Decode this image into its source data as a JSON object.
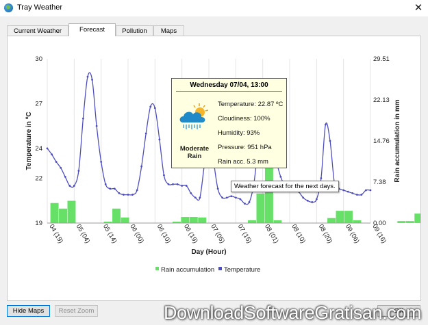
{
  "window": {
    "title": "Tray Weather",
    "close_glyph": "✕"
  },
  "tabs": [
    {
      "label": "Current Weather",
      "active": false
    },
    {
      "label": "Forecast",
      "active": true
    },
    {
      "label": "Pollution",
      "active": false
    },
    {
      "label": "Maps",
      "active": false
    }
  ],
  "popup": {
    "title": "Wednesday 07/04, 13:00",
    "condition": "Moderate Rain",
    "icon": "rain-cloud-sun-icon",
    "rows": [
      "Temperature: 22.87 ºC",
      "Cloudiness: 100%",
      "Humidity: 93%",
      "Pressure: 951 hPa",
      "Rain acc. 5.3 mm"
    ]
  },
  "tooltip": "Weather forecast for the next days.",
  "buttons": {
    "hide_maps": "Hide Maps",
    "reset_zoom": "Reset Zoom",
    "ok": "OK"
  },
  "watermark": "DownloadSoftwareGratisan.com",
  "colors": {
    "temperature": "#4d4dc0",
    "rain": "#66e066",
    "popup_bg": "#ffffe1"
  },
  "chart_data": {
    "type": "bar+line",
    "xlabel": "Day (Hour)",
    "ylabel_left": "Temperature in ºC",
    "ylabel_right": "Rain accumulation in mm",
    "x_ticks": [
      "04 (19)",
      "05 (04)",
      "05 (14)",
      "06 (00)",
      "06 (10)",
      "06 (19)",
      "07 (05)",
      "07 (15)",
      "08 (01)",
      "08 (10)",
      "08 (20)",
      "09 (06)",
      "09 (16)"
    ],
    "y_left_ticks": [
      "19",
      "22",
      "24",
      "27",
      "30"
    ],
    "y_right_ticks": [
      "0.00",
      "7.38",
      "14.76",
      "22.13",
      "29.51"
    ],
    "y_left_range": [
      19,
      30
    ],
    "y_right_range": [
      0,
      29.51
    ],
    "legend": [
      "Rain accumulation",
      "Temperature"
    ],
    "legend_position": "bottom",
    "series": [
      {
        "name": "Temperature",
        "kind": "line",
        "axis": "left",
        "x": [
          0,
          1,
          2,
          3,
          4,
          5,
          6,
          7,
          8,
          9,
          10,
          11,
          12,
          13,
          14,
          15,
          16,
          17,
          18,
          19,
          20,
          21,
          22,
          23,
          24,
          25,
          26,
          27,
          28,
          29,
          30,
          31,
          32,
          33,
          34,
          35,
          36,
          37,
          38,
          39,
          40,
          41,
          42,
          43,
          44,
          45,
          46,
          47,
          48,
          49,
          50,
          51,
          52,
          53,
          54,
          55,
          56,
          57,
          58,
          59,
          60,
          61,
          62,
          63,
          64,
          65,
          66,
          67,
          68,
          69,
          70,
          71,
          72
        ],
        "values": [
          24.0,
          23.6,
          23.1,
          22.7,
          22.1,
          21.5,
          21.5,
          22.5,
          26.0,
          28.8,
          28.6,
          25.5,
          23.1,
          21.6,
          21.3,
          21.3,
          21.0,
          20.9,
          20.9,
          20.9,
          21.2,
          22.8,
          25.0,
          26.8,
          26.7,
          24.6,
          22.2,
          21.6,
          21.6,
          21.6,
          21.5,
          21.5,
          21.0,
          20.7,
          20.7,
          22.9,
          24.7,
          23.2,
          21.3,
          20.7,
          20.7,
          20.8,
          20.7,
          20.6,
          20.3,
          20.4,
          21.6,
          24.0,
          25.4,
          25.6,
          24.6,
          23.2,
          22.1,
          21.5,
          21.4,
          21.3,
          21.1,
          20.7,
          20.5,
          20.4,
          20.6,
          22.0,
          25.6,
          24.5,
          21.6,
          21.3,
          21.2,
          21.1,
          21.0,
          20.9,
          20.9,
          21.2,
          21.2
        ]
      },
      {
        "name": "Rain accumulation",
        "kind": "bar",
        "axis": "right",
        "bars": [
          {
            "x": 0.7,
            "w": 1.9,
            "v": 3.6
          },
          {
            "x": 2.6,
            "w": 1.9,
            "v": 2.6
          },
          {
            "x": 4.5,
            "w": 1.9,
            "v": 4.0
          },
          {
            "x": 12.6,
            "w": 1.9,
            "v": 0.25
          },
          {
            "x": 14.5,
            "w": 1.9,
            "v": 2.6
          },
          {
            "x": 16.4,
            "w": 1.9,
            "v": 1.0
          },
          {
            "x": 27.9,
            "w": 1.9,
            "v": 0.25
          },
          {
            "x": 29.8,
            "w": 1.9,
            "v": 1.1
          },
          {
            "x": 31.7,
            "w": 1.9,
            "v": 1.1
          },
          {
            "x": 33.6,
            "w": 1.9,
            "v": 1.0
          },
          {
            "x": 44.7,
            "w": 1.9,
            "v": 0.5
          },
          {
            "x": 46.6,
            "w": 1.9,
            "v": 5.3
          },
          {
            "x": 48.5,
            "w": 1.9,
            "v": 11.0
          },
          {
            "x": 50.4,
            "w": 1.9,
            "v": 0.5
          },
          {
            "x": 62.4,
            "w": 1.9,
            "v": 0.9
          },
          {
            "x": 64.3,
            "w": 1.9,
            "v": 2.2
          },
          {
            "x": 66.2,
            "w": 1.9,
            "v": 2.2
          },
          {
            "x": 68.1,
            "w": 1.9,
            "v": 0.5
          },
          {
            "x": 78.0,
            "w": 1.9,
            "v": 0.35
          },
          {
            "x": 79.9,
            "w": 1.9,
            "v": 0.35
          },
          {
            "x": 81.8,
            "w": 1.9,
            "v": 1.7
          },
          {
            "x": 83.7,
            "w": 1.9,
            "v": 0.6
          }
        ]
      }
    ]
  }
}
